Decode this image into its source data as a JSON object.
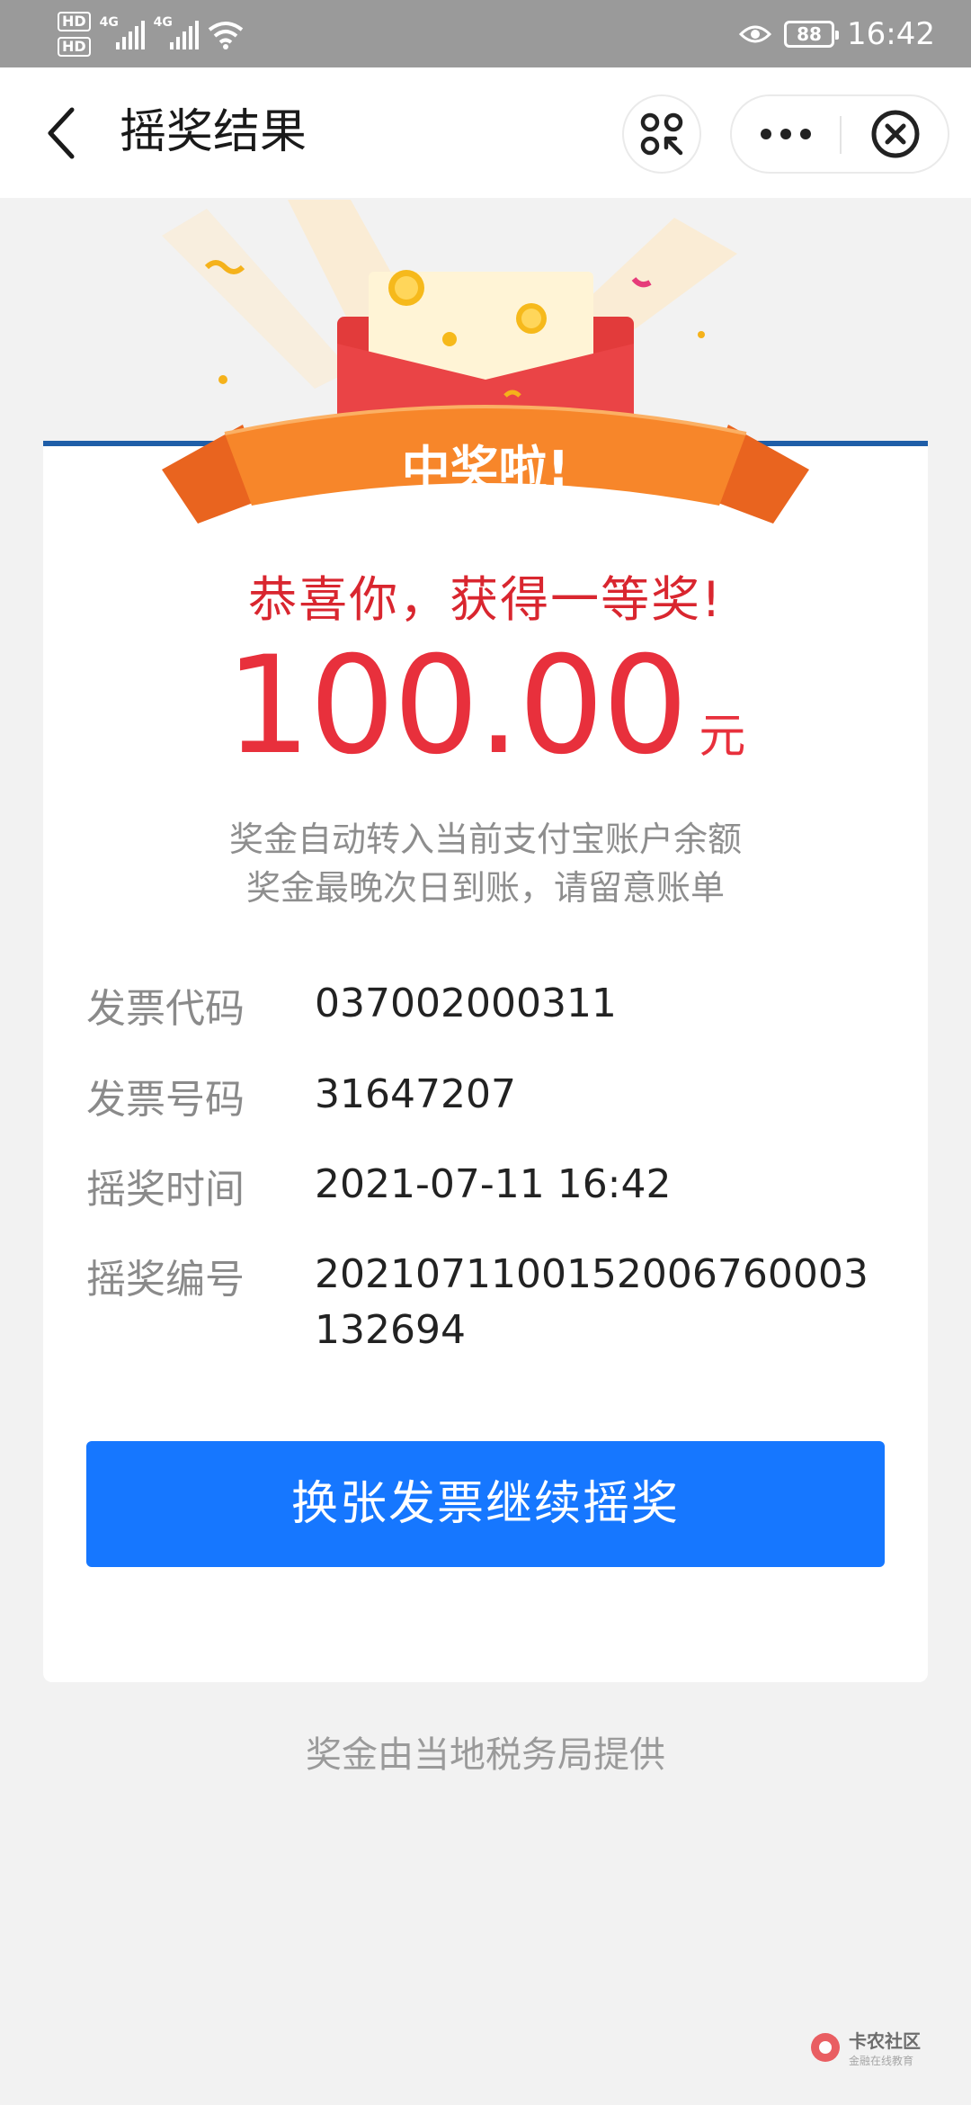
{
  "status_bar": {
    "hd1": "HD",
    "hd2": "HD",
    "sim1": "4G",
    "sim2": "4G",
    "battery": "88",
    "time": "16:42"
  },
  "nav": {
    "title": "摇奖结果"
  },
  "hero": {
    "banner_text": "中奖啦!"
  },
  "result": {
    "headline": "恭喜你，获得一等奖!",
    "amount": "100.00",
    "unit": "元",
    "note_line1": "奖金自动转入当前支付宝账户余额",
    "note_line2": "奖金最晚次日到账，请留意账单"
  },
  "info": [
    {
      "label": "发票代码",
      "value": "037002000311"
    },
    {
      "label": "发票号码",
      "value": "31647207"
    },
    {
      "label": "摇奖时间",
      "value": "2021-07-11 16:42"
    },
    {
      "label": "摇奖编号",
      "value": "2021071100152006760003132694"
    }
  ],
  "actions": {
    "retry_label": "换张发票继续摇奖"
  },
  "footer": {
    "note": "奖金由当地税务局提供"
  },
  "watermark": {
    "title": "卡农社区",
    "subtitle": "金融在线教育"
  },
  "colors": {
    "accent_red": "#e8303c",
    "button_blue": "#1677ff",
    "card_top_border": "#1f5ea8",
    "ribbon_orange": "#f7862a"
  }
}
